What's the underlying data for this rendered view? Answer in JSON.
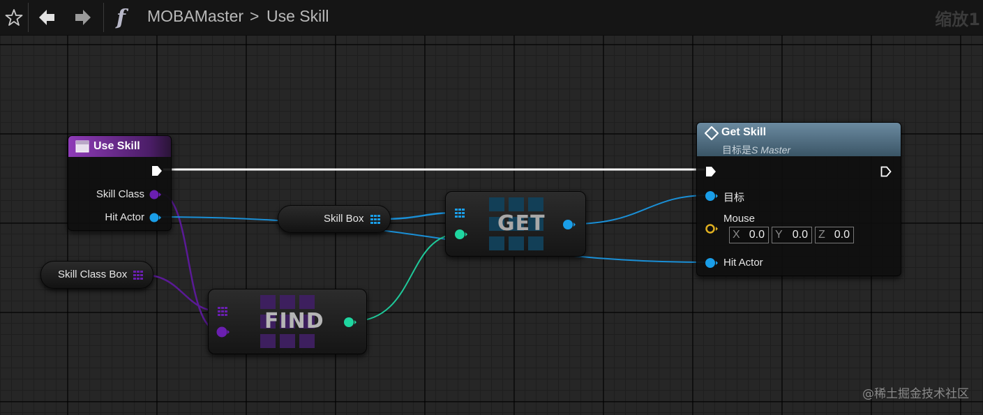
{
  "toolbar": {
    "breadcrumb": {
      "blueprint": "MOBAMaster",
      "separator": ">",
      "function": "Use Skill"
    },
    "zoom_label": "缩放1"
  },
  "nodes": {
    "use_skill": {
      "title": "Use Skill",
      "pins": {
        "skill_class": "Skill Class",
        "hit_actor": "Hit Actor"
      }
    },
    "skill_class_box": {
      "label": "Skill Class Box"
    },
    "skill_box": {
      "label": "Skill Box"
    },
    "find": {
      "title": "FIND"
    },
    "get": {
      "title": "GET"
    },
    "get_skill": {
      "title": "Get Skill",
      "subtitle_prefix": "目标是",
      "subtitle_target": "S Master",
      "pins": {
        "target": "目标",
        "mouse": "Mouse",
        "hit_actor": "Hit Actor"
      },
      "mouse_vector": {
        "x_axis": "X",
        "x": "0.0",
        "y_axis": "Y",
        "y": "0.0",
        "z_axis": "Z",
        "z": "0.0"
      }
    }
  },
  "colors": {
    "exec": "#ffffff",
    "object_pin": "#1a9ee8",
    "class_pin": "#6a1fb0",
    "int_pin": "#1fd6a0",
    "vector_pin": "#e0b020",
    "function_header": "#4e6f86",
    "event_header": "#7a2d9e"
  },
  "watermark": "@稀土掘金技术社区"
}
